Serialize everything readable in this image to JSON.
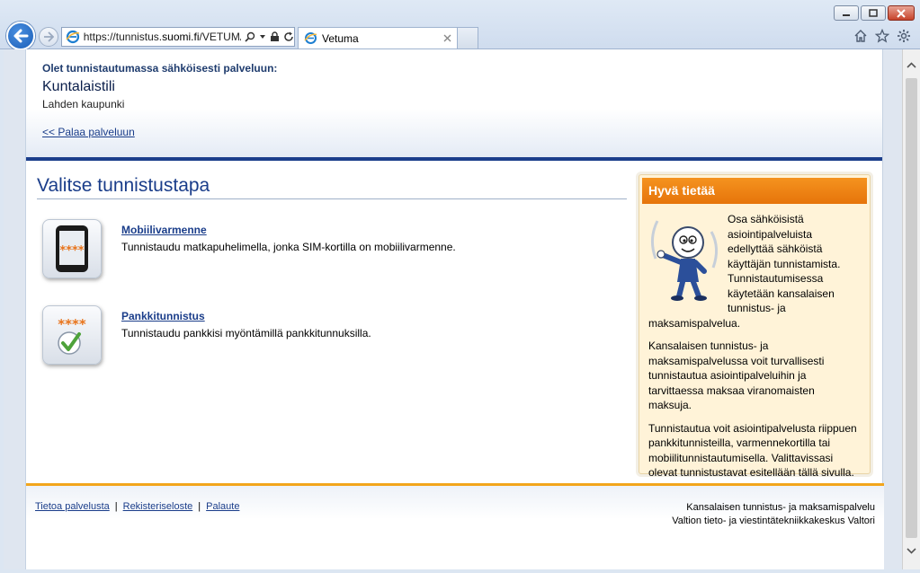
{
  "browser": {
    "url_prefix": "https://tunnistus.",
    "url_host": "suomi.fi",
    "url_rest": "/VETUMA?c",
    "tab_title": "Vetuma",
    "colors": {
      "back_button": "#1b5fb8",
      "close_button": "#c7432b"
    }
  },
  "header": {
    "intro": "Olet tunnistautumassa sähköisesti palveluun:",
    "service_name": "Kuntalaistili",
    "organization": "Lahden kaupunki",
    "back_link": "<< Palaa palveluun"
  },
  "main": {
    "heading": "Valitse tunnistustapa",
    "methods": [
      {
        "title": "Mobiilivarmenne",
        "description": "Tunnistaudu matkapuhelimella, jonka SIM-kortilla on mobiilivarmenne.",
        "icon": "mobile-phone-icon",
        "badge": "****"
      },
      {
        "title": "Pankkitunnistus",
        "description": "Tunnistaudu pankkisi myöntämillä pankkitunnuksilla.",
        "icon": "bank-check-icon",
        "badge": "****"
      }
    ]
  },
  "info": {
    "title": "Hyvä tietää",
    "paragraphs": [
      "Osa sähköisistä asiointipalveluista edellyttää sähköistä käyttäjän tunnistamista. Tunnistautumisessa käytetään kansalaisen tunnistus- ja maksamispalvelua.",
      "Kansalaisen tunnistus- ja maksamispalvelussa voit turvallisesti tunnistautua asiointipalveluihin ja tarvittaessa maksaa viranomaisten maksuja.",
      "Tunnistautua voit asiointipalvelusta riippuen pankkitunnisteilla, varmennekortilla tai mobiilitunnistautumisella. Valittavissasi olevat tunnistustavat esitellään tällä sivulla."
    ],
    "colors": {
      "header": "#e6740a",
      "background": "#fff3d8"
    }
  },
  "footer": {
    "links": [
      "Tietoa palvelusta",
      "Rekisteriseloste",
      "Palaute"
    ],
    "separator": "|",
    "credits": [
      "Kansalaisen tunnistus- ja maksamispalvelu",
      "Valtion tieto- ja viestintätekniikkakeskus Valtori"
    ],
    "colors": {
      "accent": "#f2a61c",
      "link": "#1a3d8a"
    }
  }
}
